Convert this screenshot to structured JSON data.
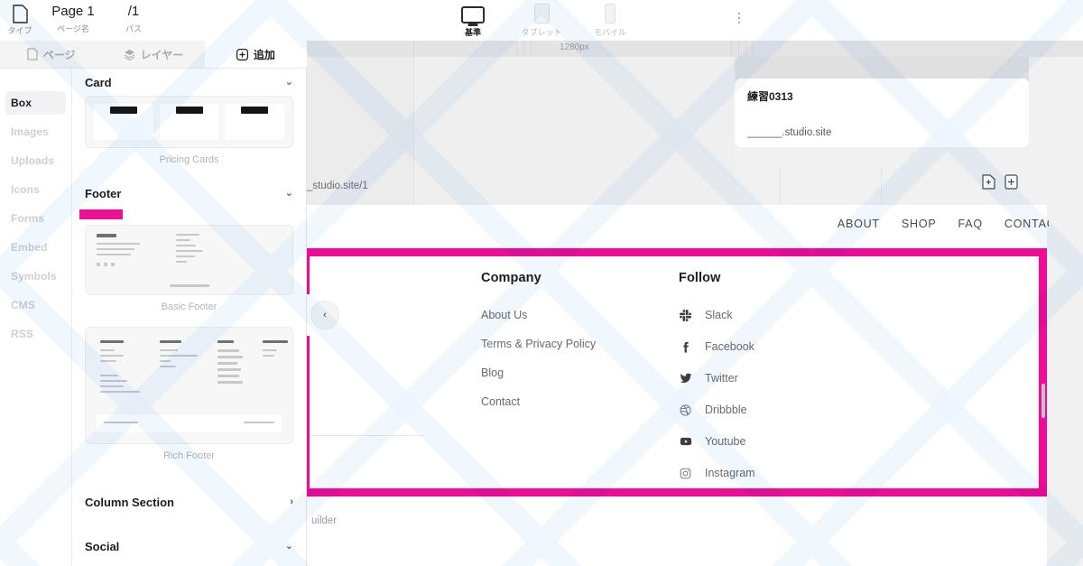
{
  "app": {
    "accent_color": "#EF0B96",
    "canvas_bg": "#F1F1F1"
  },
  "topbar": {
    "type_label": "タイプ",
    "type_icon": "page-document-icon",
    "page_name_value": "Page 1",
    "page_name_label": "ページ名",
    "path_value": "/1",
    "path_label": "パス",
    "more_icon": "kebab-menu-icon",
    "devices": [
      {
        "label": "基準",
        "icon": "desktop-icon",
        "active": true
      },
      {
        "label": "タブレット",
        "icon": "tablet-icon",
        "active": false
      },
      {
        "label": "モバイル",
        "icon": "mobile-icon",
        "active": false
      }
    ]
  },
  "panel_tabs": [
    {
      "label": "ページ",
      "icon": "page-icon",
      "active": false
    },
    {
      "label": "レイヤー",
      "icon": "layers-icon",
      "active": false
    },
    {
      "label": "追加",
      "icon": "plus-circle-icon",
      "active": true
    }
  ],
  "rail": {
    "items": [
      {
        "label": "Box",
        "active": true
      },
      {
        "label": "Images",
        "active": false
      },
      {
        "label": "Uploads",
        "active": false
      },
      {
        "label": "Icons",
        "active": false
      },
      {
        "label": "Forms",
        "active": false
      },
      {
        "label": "Embed",
        "active": false
      },
      {
        "label": "Symbols",
        "active": false
      },
      {
        "label": "CMS",
        "active": false
      },
      {
        "label": "RSS",
        "active": false
      }
    ]
  },
  "add_panel": {
    "sections": [
      {
        "title": "Card",
        "chevron": "⌄",
        "expanded": true
      },
      {
        "title": "Footer",
        "chevron": "⌄",
        "expanded": true
      },
      {
        "title": "Column Section",
        "chevron": "›",
        "expanded": false
      },
      {
        "title": "Social",
        "chevron": "⌄",
        "expanded": true
      }
    ],
    "card_items": [
      {
        "caption": "Pricing Cards"
      }
    ],
    "footer_items": [
      {
        "caption": "Basic Footer"
      },
      {
        "caption": "Rich Footer"
      }
    ]
  },
  "canvas": {
    "ruler_label": "1280px",
    "site_card": {
      "title": "練習0313",
      "url": "______.studio.site"
    },
    "page_url": "_studio.site/1",
    "add_page_icon": "add-page-icon",
    "add_section_icon": "add-block-icon",
    "collapse_icon": "‹",
    "builder_text": "uilder",
    "site_nav": [
      {
        "label": "ABOUT"
      },
      {
        "label": "SHOP"
      },
      {
        "label": "FAQ"
      },
      {
        "label": "CONTACT"
      }
    ],
    "footer": {
      "columns": [
        {
          "heading": "Company",
          "type": "links",
          "items": [
            {
              "label": "About Us"
            },
            {
              "label": "Terms & Privacy Policy"
            },
            {
              "label": "Blog"
            },
            {
              "label": "Contact"
            }
          ]
        },
        {
          "heading": "Follow",
          "type": "social",
          "items": [
            {
              "label": "Slack",
              "icon": "slack-icon"
            },
            {
              "label": "Facebook",
              "icon": "facebook-icon"
            },
            {
              "label": "Twitter",
              "icon": "twitter-icon"
            },
            {
              "label": "Dribbble",
              "icon": "dribbble-icon"
            },
            {
              "label": "Youtube",
              "icon": "youtube-icon"
            },
            {
              "label": "Instagram",
              "icon": "instagram-icon"
            }
          ]
        }
      ]
    }
  }
}
